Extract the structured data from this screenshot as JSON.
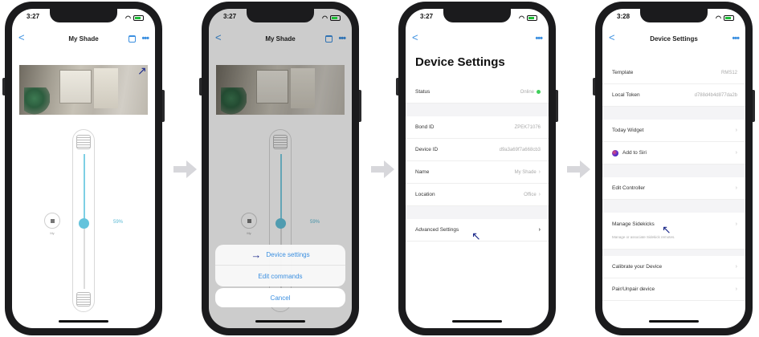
{
  "screen1": {
    "time": "3:27",
    "title": "My Shade",
    "back": "<",
    "more": "•••",
    "slider_percent": "59%",
    "slider_level": 0.59,
    "stop_label": "My"
  },
  "screen2": {
    "time": "3:27",
    "title": "My Shade",
    "back": "<",
    "more": "•••",
    "slider_percent": "59%",
    "stop_label": "My",
    "sheet": {
      "device_settings": "Device settings",
      "edit_commands": "Edit commands",
      "cancel": "Cancel"
    }
  },
  "screen3": {
    "time": "3:27",
    "back": "<",
    "more": "•••",
    "title": "Device Settings",
    "status": {
      "label": "Status",
      "value": "Online"
    },
    "bond_id": {
      "label": "Bond ID",
      "value": "ZPEK71076"
    },
    "device_id": {
      "label": "Device ID",
      "value": "d9a3a69f7a668cb3"
    },
    "name": {
      "label": "Name",
      "value": "My Shade"
    },
    "location": {
      "label": "Location",
      "value": "Office"
    },
    "advanced": {
      "label": "Advanced Settings"
    }
  },
  "screen4": {
    "time": "3:28",
    "back": "<",
    "more": "•••",
    "title": "Device Settings",
    "template": {
      "label": "Template",
      "value": "RMS12"
    },
    "local_token": {
      "label": "Local Token",
      "value": "d788d4b4d877da2b"
    },
    "today_widget": {
      "label": "Today Widget"
    },
    "siri": {
      "label": "Add to Siri"
    },
    "edit_controller": {
      "label": "Edit Controller"
    },
    "sidekicks": {
      "label": "Manage Sidekicks",
      "desc": "Manage or associate Sidekick remotes."
    },
    "calibrate": {
      "label": "Calibrate your Device"
    },
    "pair": {
      "label": "Pair/Unpair device"
    }
  },
  "colors": {
    "accent": "#3b8fe0",
    "slider": "#64c3dc",
    "online": "#3fcf5a",
    "annotation": "#1c2a8a",
    "flow_arrow": "#d7d7db"
  },
  "icons": [
    "back-chevron-icon",
    "calendar-icon",
    "more-icon",
    "stop-icon",
    "shade-up-icon",
    "shade-down-icon",
    "annotation-arrow-icon",
    "chevron-right-icon",
    "siri-icon",
    "flow-arrow-icon"
  ]
}
